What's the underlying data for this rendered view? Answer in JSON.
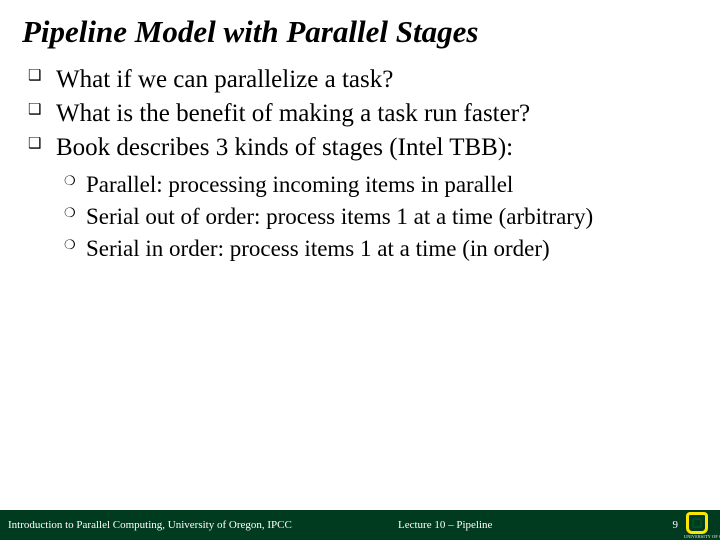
{
  "title": "Pipeline Model with Parallel Stages",
  "bullets": [
    {
      "text": "What if we can parallelize a task?"
    },
    {
      "text": "What is the benefit of making a task run faster?"
    },
    {
      "text": "Book describes 3 kinds of stages (Intel TBB):"
    }
  ],
  "subbullets": [
    {
      "text": "Parallel: processing incoming items in parallel"
    },
    {
      "text": "Serial out of order: process items 1 at a time (arbitrary)"
    },
    {
      "text": "Serial in order: process items 1 at a time (in order)"
    }
  ],
  "footer": {
    "left": "Introduction to Parallel Computing, University of Oregon, IPCC",
    "center": "Lecture 10 – Pipeline",
    "page": "9",
    "logo_alt": "University of Oregon"
  }
}
